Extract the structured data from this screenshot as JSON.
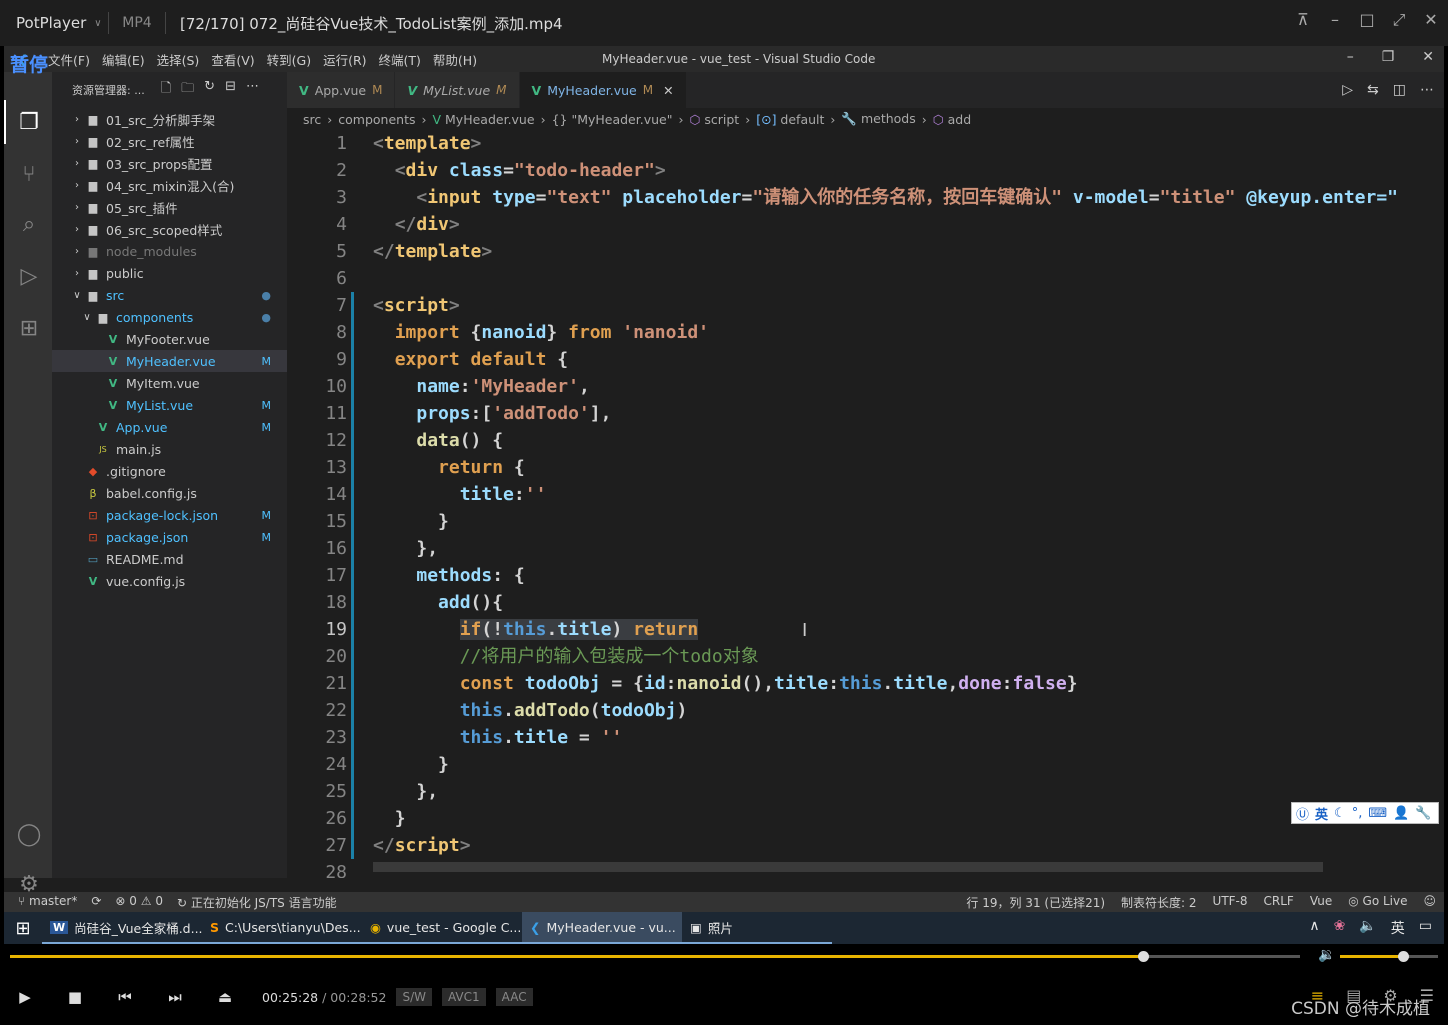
{
  "player": {
    "brand": "PotPlayer",
    "format": "MP4",
    "file": "[72/170] 072_尚硅谷Vue技术_TodoList案例_添加.mp4",
    "pause_label": "暂停",
    "time_current": "00:25:28",
    "time_total": "/ 00:28:52",
    "badges": [
      "S/W",
      "AVC1",
      "AAC"
    ],
    "progress": 0.878,
    "volume": 0.64,
    "watermark": "CSDN @待木成植"
  },
  "vscode": {
    "window_title": "MyHeader.vue - vue_test - Visual Studio Code",
    "menu": [
      "文件(F)",
      "编辑(E)",
      "选择(S)",
      "查看(V)",
      "转到(G)",
      "运行(R)",
      "终端(T)",
      "帮助(H)"
    ],
    "explorer_title": "资源管理器: ...",
    "tree": [
      {
        "label": "01_src_分析脚手架",
        "type": "folder",
        "depth": 0
      },
      {
        "label": "02_src_ref属性",
        "type": "folder",
        "depth": 0
      },
      {
        "label": "03_src_props配置",
        "type": "folder",
        "depth": 0
      },
      {
        "label": "04_src_mixin混入(合)",
        "type": "folder",
        "depth": 0
      },
      {
        "label": "05_src_插件",
        "type": "folder",
        "depth": 0
      },
      {
        "label": "06_src_scoped样式",
        "type": "folder",
        "depth": 0
      },
      {
        "label": "node_modules",
        "type": "folder",
        "depth": 0,
        "dim": true
      },
      {
        "label": "public",
        "type": "folder",
        "depth": 0
      },
      {
        "label": "src",
        "type": "folder-open",
        "depth": 0,
        "color": "blue",
        "marker": "●"
      },
      {
        "label": "components",
        "type": "folder-open",
        "depth": 1,
        "color": "blue",
        "marker": "●"
      },
      {
        "label": "MyFooter.vue",
        "type": "vue",
        "depth": 2
      },
      {
        "label": "MyHeader.vue",
        "type": "vue",
        "depth": 2,
        "color": "blue",
        "marker": "M",
        "selected": true
      },
      {
        "label": "MyItem.vue",
        "type": "vue",
        "depth": 2
      },
      {
        "label": "MyList.vue",
        "type": "vue",
        "depth": 2,
        "color": "blue",
        "marker": "M"
      },
      {
        "label": "App.vue",
        "type": "vue",
        "depth": 1,
        "color": "blue",
        "marker": "M"
      },
      {
        "label": "main.js",
        "type": "js",
        "depth": 1
      },
      {
        "label": ".gitignore",
        "type": "git",
        "depth": 0
      },
      {
        "label": "babel.config.js",
        "type": "babel",
        "depth": 0
      },
      {
        "label": "package-lock.json",
        "type": "json",
        "depth": 0,
        "color": "blue",
        "marker": "M"
      },
      {
        "label": "package.json",
        "type": "json",
        "depth": 0,
        "color": "blue",
        "marker": "M"
      },
      {
        "label": "README.md",
        "type": "md",
        "depth": 0
      },
      {
        "label": "vue.config.js",
        "type": "vue",
        "depth": 0
      }
    ],
    "tabs": [
      {
        "label": "App.vue",
        "mark": "M",
        "active": false
      },
      {
        "label": "MyList.vue",
        "mark": "M",
        "active": false
      },
      {
        "label": "MyHeader.vue",
        "mark": "M",
        "active": true
      }
    ],
    "breadcrumb": [
      "src",
      "components",
      "MyHeader.vue",
      "{} \"MyHeader.vue\"",
      "script",
      "default",
      "methods",
      "add"
    ],
    "current_line": 19,
    "status": {
      "branch": "master*",
      "errors": "0",
      "warnings": "0",
      "task": "正在初始化 JS/TS 语言功能",
      "position": "行 19，列 31 (已选择21)",
      "tab_size": "制表符长度: 2",
      "encoding": "UTF-8",
      "eol": "CRLF",
      "lang": "Vue",
      "golive": "Go Live"
    },
    "ime_label": "英"
  },
  "code": [
    [
      [
        "<",
        "t-brk"
      ],
      [
        "template",
        "t-tagn"
      ],
      [
        ">",
        "t-brk"
      ]
    ],
    [
      [
        "  ",
        ""
      ],
      [
        "<",
        "t-brk"
      ],
      [
        "div ",
        "t-tagn"
      ],
      [
        "class",
        "t-attr"
      ],
      [
        "=",
        "t-pn"
      ],
      [
        "\"todo-header\"",
        "t-str"
      ],
      [
        ">",
        "t-brk"
      ]
    ],
    [
      [
        "    ",
        ""
      ],
      [
        "<",
        "t-brk"
      ],
      [
        "input ",
        "t-tagn"
      ],
      [
        "type",
        "t-attr"
      ],
      [
        "=",
        "t-pn"
      ],
      [
        "\"text\" ",
        "t-str"
      ],
      [
        "placeholder",
        "t-attr"
      ],
      [
        "=",
        "t-pn"
      ],
      [
        "\"请输入你的任务名称，按回车键确认\" ",
        "t-str"
      ],
      [
        "v-model",
        "t-attr"
      ],
      [
        "=",
        "t-pn"
      ],
      [
        "\"title\" ",
        "t-str"
      ],
      [
        "@keyup.enter=\"",
        "t-attr"
      ]
    ],
    [
      [
        "  ",
        ""
      ],
      [
        "</",
        "t-brk"
      ],
      [
        "div",
        "t-tagn"
      ],
      [
        ">",
        "t-brk"
      ]
    ],
    [
      [
        "</",
        "t-brk"
      ],
      [
        "template",
        "t-tagn"
      ],
      [
        ">",
        "t-brk"
      ]
    ],
    [],
    [
      [
        "<",
        "t-brk"
      ],
      [
        "script",
        "t-tagn"
      ],
      [
        ">",
        "t-brk"
      ]
    ],
    [
      [
        "  ",
        ""
      ],
      [
        "import ",
        "t-orange"
      ],
      [
        "{",
        "t-pn"
      ],
      [
        "nanoid",
        "t-var"
      ],
      [
        "} ",
        "t-pn"
      ],
      [
        "from ",
        "t-orange"
      ],
      [
        "'nanoid'",
        "t-str"
      ]
    ],
    [
      [
        "  ",
        ""
      ],
      [
        "export default ",
        "t-orange"
      ],
      [
        "{",
        "t-pn"
      ]
    ],
    [
      [
        "    ",
        ""
      ],
      [
        "name",
        "t-var"
      ],
      [
        ":",
        "t-pn"
      ],
      [
        "'MyHeader'",
        "t-str"
      ],
      [
        ",",
        "t-pn"
      ]
    ],
    [
      [
        "    ",
        ""
      ],
      [
        "props",
        "t-var"
      ],
      [
        ":[",
        "t-pn"
      ],
      [
        "'addTodo'",
        "t-str"
      ],
      [
        "],",
        "t-pn"
      ]
    ],
    [
      [
        "    ",
        ""
      ],
      [
        "data",
        "t-fn"
      ],
      [
        "() {",
        "t-pn"
      ]
    ],
    [
      [
        "      ",
        ""
      ],
      [
        "return ",
        "t-orange"
      ],
      [
        "{",
        "t-pn"
      ]
    ],
    [
      [
        "        ",
        ""
      ],
      [
        "title",
        "t-var"
      ],
      [
        ":",
        "t-pn"
      ],
      [
        "''",
        "t-str"
      ]
    ],
    [
      [
        "      ",
        ""
      ],
      [
        "}",
        "t-pn"
      ]
    ],
    [
      [
        "    ",
        ""
      ],
      [
        "},",
        "t-pn"
      ]
    ],
    [
      [
        "    ",
        ""
      ],
      [
        "methods",
        "t-var"
      ],
      [
        ": {",
        "t-pn"
      ]
    ],
    [
      [
        "      ",
        ""
      ],
      [
        "add",
        "t-var"
      ],
      [
        "(){",
        "t-pn"
      ]
    ],
    [
      [
        "        ",
        ""
      ],
      [
        "if",
        "t-orange"
      ],
      [
        "(!",
        "t-pn"
      ],
      [
        "this",
        "t-this"
      ],
      [
        ".",
        "t-pn"
      ],
      [
        "title",
        "t-var"
      ],
      [
        ") ",
        "t-pn"
      ],
      [
        "return",
        "t-orange"
      ]
    ],
    [
      [
        "        ",
        ""
      ],
      [
        "//将用户的输入包装成一个todo对象",
        "t-cm"
      ]
    ],
    [
      [
        "        ",
        ""
      ],
      [
        "const ",
        "t-orange"
      ],
      [
        "todoObj",
        "t-var"
      ],
      [
        " = {",
        "t-pn"
      ],
      [
        "id",
        "t-var"
      ],
      [
        ":",
        "t-pn"
      ],
      [
        "nanoid",
        "t-fn"
      ],
      [
        "(),",
        "t-pn"
      ],
      [
        "title",
        "t-var"
      ],
      [
        ":",
        "t-pn"
      ],
      [
        "this",
        "t-this"
      ],
      [
        ".",
        "t-pn"
      ],
      [
        "title",
        "t-var"
      ],
      [
        ",",
        "t-pn"
      ],
      [
        "done",
        "t-prop"
      ],
      [
        ":",
        "t-pn"
      ],
      [
        "false",
        "t-prop"
      ],
      [
        "}",
        "t-pn"
      ]
    ],
    [
      [
        "        ",
        ""
      ],
      [
        "this",
        "t-this"
      ],
      [
        ".",
        "t-pn"
      ],
      [
        "addTodo",
        "t-fn"
      ],
      [
        "(",
        "t-pn"
      ],
      [
        "todoObj",
        "t-var"
      ],
      [
        ")",
        "t-pn"
      ]
    ],
    [
      [
        "        ",
        ""
      ],
      [
        "this",
        "t-this"
      ],
      [
        ".",
        "t-pn"
      ],
      [
        "title",
        "t-var"
      ],
      [
        " = ",
        "t-pn"
      ],
      [
        "''",
        "t-str"
      ]
    ],
    [
      [
        "      ",
        ""
      ],
      [
        "}",
        "t-pn"
      ]
    ],
    [
      [
        "    ",
        ""
      ],
      [
        "},",
        "t-pn"
      ]
    ],
    [
      [
        "  ",
        ""
      ],
      [
        "}",
        "t-pn"
      ]
    ],
    [
      [
        "</",
        "t-brk"
      ],
      [
        "script",
        "t-tagn"
      ],
      [
        ">",
        "t-brk"
      ]
    ],
    []
  ],
  "taskbar": {
    "apps": [
      {
        "label": "尚硅谷_Vue全家桶.d...",
        "icon": "W"
      },
      {
        "label": "C:\\Users\\tianyu\\Des...",
        "icon": "S"
      },
      {
        "label": "vue_test - Google C...",
        "icon": "◉"
      },
      {
        "label": "MyHeader.vue - vu...",
        "icon": "❮",
        "active": true
      },
      {
        "label": "照片",
        "icon": "▣"
      }
    ],
    "ime": "英"
  }
}
